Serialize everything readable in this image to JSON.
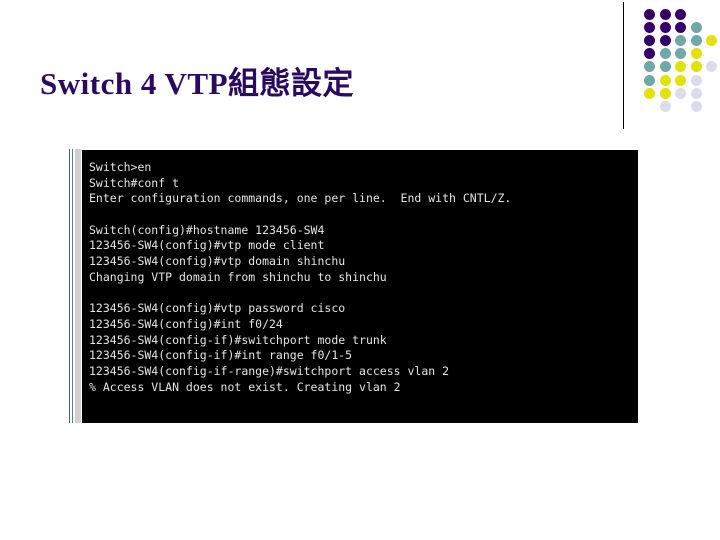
{
  "slide": {
    "title": "Switch 4 VTP組態設定",
    "title_color": "#2a0a5e",
    "background_color": "#ffffff"
  },
  "decoration": {
    "divider_color": "#000000",
    "palette": {
      "dark_purple": "#33006b",
      "purple": "#3b0a78",
      "teal": "#6fa8a8",
      "yellow": "#e2e209",
      "lavender": "#dcdcec"
    },
    "dots": [
      {
        "col": 0,
        "row": 0,
        "color": "#33006b"
      },
      {
        "col": 1,
        "row": 0,
        "color": "#33006b"
      },
      {
        "col": 2,
        "row": 0,
        "color": "#33006b"
      },
      {
        "col": 0,
        "row": 1,
        "color": "#33006b"
      },
      {
        "col": 1,
        "row": 1,
        "color": "#33006b"
      },
      {
        "col": 2,
        "row": 1,
        "color": "#33006b"
      },
      {
        "col": 3,
        "row": 1,
        "color": "#6fa8a8"
      },
      {
        "col": 0,
        "row": 2,
        "color": "#33006b"
      },
      {
        "col": 1,
        "row": 2,
        "color": "#33006b"
      },
      {
        "col": 2,
        "row": 2,
        "color": "#6fa8a8"
      },
      {
        "col": 3,
        "row": 2,
        "color": "#6fa8a8"
      },
      {
        "col": 4,
        "row": 2,
        "color": "#e2e209"
      },
      {
        "col": 0,
        "row": 3,
        "color": "#33006b"
      },
      {
        "col": 1,
        "row": 3,
        "color": "#6fa8a8"
      },
      {
        "col": 2,
        "row": 3,
        "color": "#6fa8a8"
      },
      {
        "col": 3,
        "row": 3,
        "color": "#e2e209"
      },
      {
        "col": 0,
        "row": 4,
        "color": "#6fa8a8"
      },
      {
        "col": 1,
        "row": 4,
        "color": "#6fa8a8"
      },
      {
        "col": 2,
        "row": 4,
        "color": "#e2e209"
      },
      {
        "col": 3,
        "row": 4,
        "color": "#e2e209"
      },
      {
        "col": 4,
        "row": 4,
        "color": "#dcdcec"
      },
      {
        "col": 0,
        "row": 5,
        "color": "#6fa8a8"
      },
      {
        "col": 1,
        "row": 5,
        "color": "#e2e209"
      },
      {
        "col": 2,
        "row": 5,
        "color": "#e2e209"
      },
      {
        "col": 3,
        "row": 5,
        "color": "#dcdcec"
      },
      {
        "col": 0,
        "row": 6,
        "color": "#e2e209"
      },
      {
        "col": 1,
        "row": 6,
        "color": "#e2e209"
      },
      {
        "col": 2,
        "row": 6,
        "color": "#dcdcec"
      },
      {
        "col": 3,
        "row": 6,
        "color": "#dcdcec"
      },
      {
        "col": 1,
        "row": 7,
        "color": "#dcdcec"
      },
      {
        "col": 3,
        "row": 7,
        "color": "#dcdcec"
      }
    ]
  },
  "terminal": {
    "background_color": "#000000",
    "text_color": "#e4e4e4",
    "lines": [
      "Switch>en",
      "Switch#conf t",
      "Enter configuration commands, one per line.  End with CNTL/Z.",
      "",
      "Switch(config)#hostname 123456-SW4",
      "123456-SW4(config)#vtp mode client",
      "123456-SW4(config)#vtp domain shinchu",
      "Changing VTP domain from shinchu to shinchu",
      "",
      "123456-SW4(config)#vtp password cisco",
      "123456-SW4(config)#int f0/24",
      "123456-SW4(config-if)#switchport mode trunk",
      "123456-SW4(config-if)#int range f0/1-5",
      "123456-SW4(config-if-range)#switchport access vlan 2",
      "% Access VLAN does not exist. Creating vlan 2"
    ]
  }
}
